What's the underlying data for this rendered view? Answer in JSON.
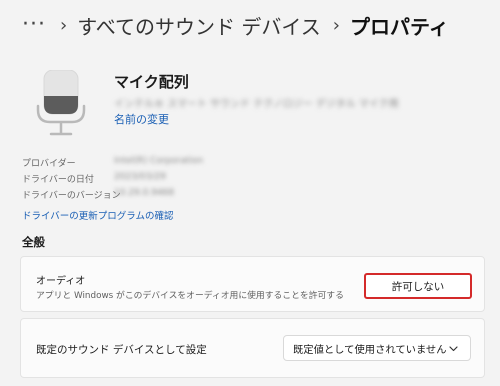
{
  "breadcrumb": {
    "more_label": "···",
    "separator": "›",
    "parent": "すべてのサウンド デバイス",
    "current": "プロパティ"
  },
  "device": {
    "icon": "microphone-icon",
    "name": "マイク配列",
    "subtitle": "インテル® スマート サウンド テクノロジー デジタル マイク用",
    "rename_link": "名前の変更"
  },
  "info": {
    "rows": [
      {
        "label": "プロバイダー",
        "value": "Intel(R) Corporation"
      },
      {
        "label": "ドライバーの日付",
        "value": "2023/03/29"
      },
      {
        "label": "ドライバーのバージョン",
        "value": "10.29.0.9468"
      }
    ],
    "update_link": "ドライバーの更新プログラムの確認"
  },
  "general": {
    "heading": "全般",
    "audio": {
      "title": "オーディオ",
      "description": "アプリと Windows がこのデバイスをオーディオ用に使用することを許可する",
      "button_label": "許可しない",
      "highlight_color": "#d42a2a"
    },
    "default_device": {
      "title": "既定のサウンド デバイスとして設定",
      "selected_value": "既定値として使用されていません",
      "dropdown_icon": "chevron-down-icon"
    }
  },
  "colors": {
    "background": "#f3f3f3",
    "card": "#fbfbfb",
    "link": "#1a5fb4"
  }
}
